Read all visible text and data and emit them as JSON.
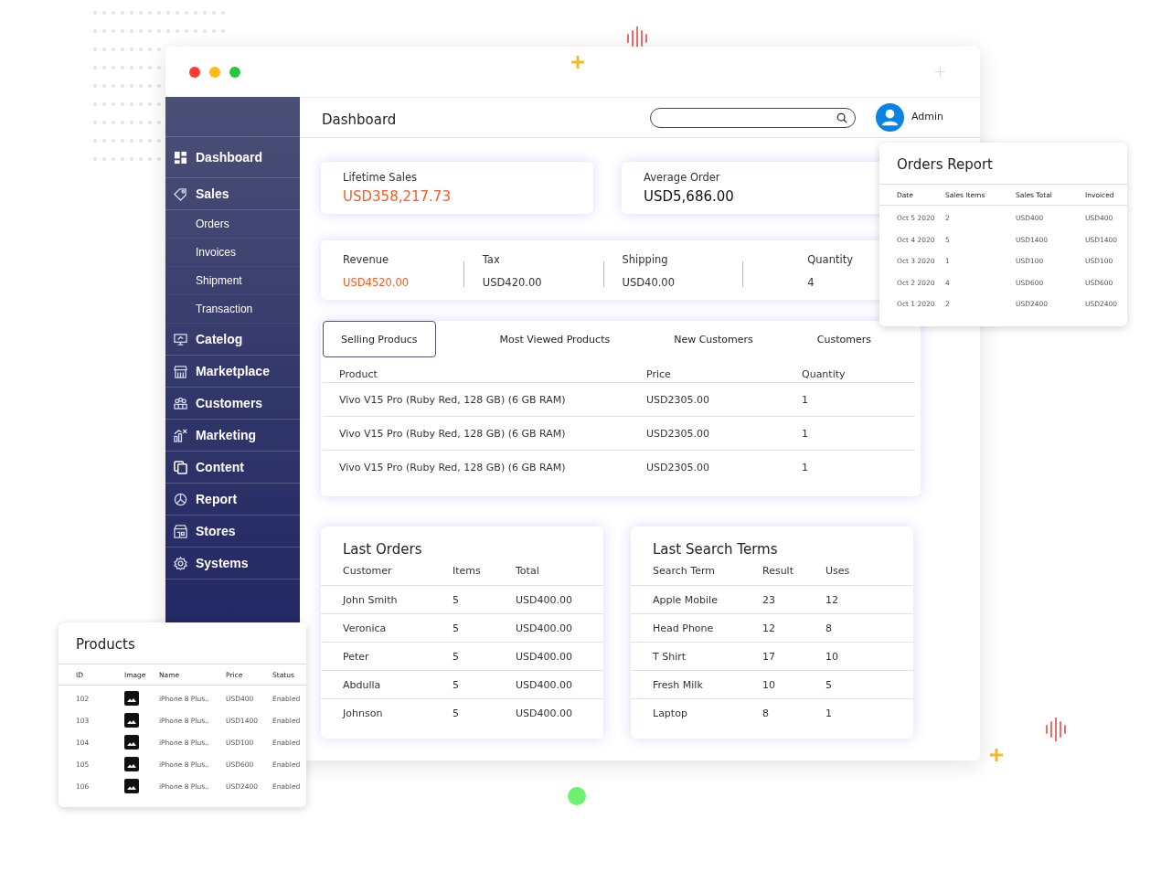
{
  "sidebar": {
    "items": [
      {
        "label": "Dashboard"
      },
      {
        "label": "Sales",
        "children": [
          {
            "label": "Orders"
          },
          {
            "label": "Invoices"
          },
          {
            "label": "Shipment"
          },
          {
            "label": "Transaction"
          }
        ]
      },
      {
        "label": "Catelog"
      },
      {
        "label": "Marketplace"
      },
      {
        "label": "Customers"
      },
      {
        "label": "Marketing"
      },
      {
        "label": "Content"
      },
      {
        "label": "Report"
      },
      {
        "label": "Stores"
      },
      {
        "label": "Systems"
      }
    ]
  },
  "header": {
    "title": "Dashboard",
    "user": "Admin"
  },
  "stats": [
    {
      "label": "Lifetime Sales",
      "value": "USD358,217.73",
      "highlighted": true
    },
    {
      "label": "Average Order",
      "value": "USD5,686.00",
      "highlighted": false
    }
  ],
  "totals": [
    {
      "label": "Revenue",
      "value": "USD4520.00",
      "highlighted": true
    },
    {
      "label": "Tax",
      "value": "USD420.00",
      "highlighted": false
    },
    {
      "label": "Shipping",
      "value": "USD40.00",
      "highlighted": false
    },
    {
      "label": "Quantity",
      "value": "4",
      "highlighted": false
    }
  ],
  "product_tabs": {
    "tabs": [
      {
        "label": "Selling Producs",
        "selected": true
      },
      {
        "label": "Most Viewed Products",
        "selected": false
      },
      {
        "label": "New Customers",
        "selected": false
      },
      {
        "label": "Customers",
        "selected": false
      }
    ],
    "columns": [
      "Product",
      "Price",
      "Quantity"
    ],
    "rows": [
      [
        "Vivo V15 Pro (Ruby Red, 128 GB) (6 GB RAM)",
        "USD2305.00",
        "1"
      ],
      [
        "Vivo V15 Pro (Ruby Red, 128 GB) (6 GB RAM)",
        "USD2305.00",
        "1"
      ],
      [
        "Vivo V15 Pro (Ruby Red, 128 GB) (6 GB RAM)",
        "USD2305.00",
        "1"
      ]
    ]
  },
  "last_orders": {
    "title": "Last Orders",
    "columns": [
      "Customer",
      "Items",
      "Total"
    ],
    "rows": [
      [
        "John Smith",
        "5",
        "USD400.00"
      ],
      [
        "Veronica",
        "5",
        "USD400.00"
      ],
      [
        "Peter",
        "5",
        "USD400.00"
      ],
      [
        "Abdulla",
        "5",
        "USD400.00"
      ],
      [
        "Johnson",
        "5",
        "USD400.00"
      ]
    ]
  },
  "last_search_terms": {
    "title": "Last Search Terms",
    "columns": [
      "Search Term",
      "Result",
      "Uses"
    ],
    "rows": [
      [
        "Apple Mobile",
        "23",
        "12"
      ],
      [
        "Head Phone",
        "12",
        "8"
      ],
      [
        "T Shirt",
        "17",
        "10"
      ],
      [
        "Fresh Milk",
        "10",
        "5"
      ],
      [
        "Laptop",
        "8",
        "1"
      ]
    ]
  },
  "orders_report": {
    "title": "Orders Report",
    "columns": [
      "Date",
      "Sales Items",
      "Sales Total",
      "Invoiced"
    ],
    "rows": [
      [
        "Oct 5 2020",
        "2",
        "USD400",
        "USD400"
      ],
      [
        "Oct 4 2020",
        "5",
        "USD1400",
        "USD1400"
      ],
      [
        "Oct 3 2020",
        "1",
        "USD100",
        "USD100"
      ],
      [
        "Oct 2 2020",
        "4",
        "USD600",
        "USD600"
      ],
      [
        "Oct 1 2020",
        "2",
        "USD2400",
        "USD2400"
      ]
    ]
  },
  "products": {
    "title": "Products",
    "columns": [
      "ID",
      "Image",
      "Name",
      "Price",
      "Status"
    ],
    "rows": [
      {
        "id": "102",
        "name": "iPhone 8 Plus..",
        "price": "USD400",
        "status": "Enabled"
      },
      {
        "id": "103",
        "name": "iPhone 8 Plus..",
        "price": "USD1400",
        "status": "Enabled"
      },
      {
        "id": "104",
        "name": "iPhone 8 Plus..",
        "price": "USD100",
        "status": "Enabled"
      },
      {
        "id": "105",
        "name": "iPhone 8 Plus..",
        "price": "USD600",
        "status": "Enabled"
      },
      {
        "id": "106",
        "name": "iPhone 8 Plus..",
        "price": "USD2400",
        "status": "Enabled"
      }
    ]
  }
}
